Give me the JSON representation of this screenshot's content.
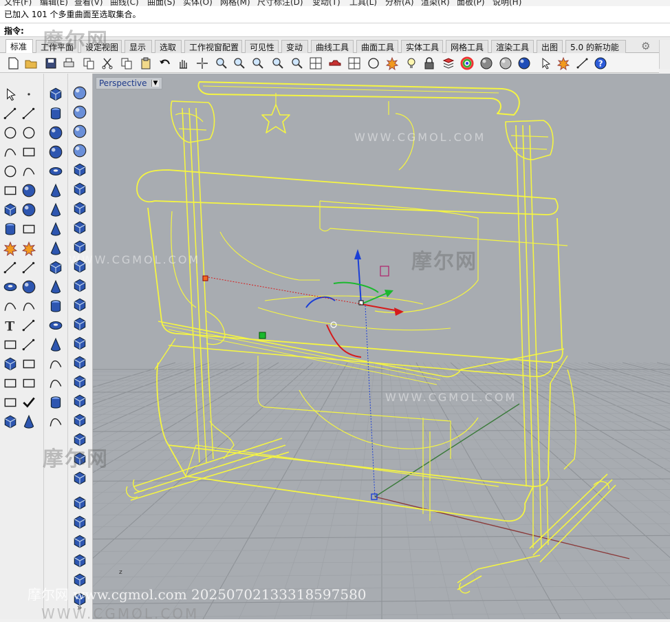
{
  "menubar": {
    "items": [
      "文件(F)",
      "编辑(E)",
      "查看(V)",
      "曲线(C)",
      "曲面(S)",
      "实体(O)",
      "网格(M)",
      "尺寸标注(D)",
      "变动(T)",
      "工具(L)",
      "分析(A)",
      "渲染(R)",
      "面板(P)",
      "说明(H)"
    ]
  },
  "command": {
    "history": "已加入 101 个多重曲面至选取集合。",
    "prompt_label": "指令:",
    "prompt_value": ""
  },
  "tabs": [
    {
      "label": "标准",
      "active": true
    },
    {
      "label": "工作平面",
      "active": false
    },
    {
      "label": "设定视图",
      "active": false
    },
    {
      "label": "显示",
      "active": false
    },
    {
      "label": "选取",
      "active": false
    },
    {
      "label": "工作视窗配置",
      "active": false
    },
    {
      "label": "可见性",
      "active": false
    },
    {
      "label": "变动",
      "active": false
    },
    {
      "label": "曲线工具",
      "active": false
    },
    {
      "label": "曲面工具",
      "active": false
    },
    {
      "label": "实体工具",
      "active": false
    },
    {
      "label": "网格工具",
      "active": false
    },
    {
      "label": "渲染工具",
      "active": false
    },
    {
      "label": "出图",
      "active": false
    },
    {
      "label": "5.0 的新功能",
      "active": false
    }
  ],
  "toolbar": {
    "icons": [
      "new-file-icon",
      "open-folder-icon",
      "save-icon",
      "print-icon",
      "import-icon",
      "cut-icon",
      "copy-icon",
      "paste-icon",
      "undo-icon",
      "pan-hand-icon",
      "move-icon",
      "zoom-icon",
      "zoom-window-icon",
      "zoom-extents-icon",
      "zoom-selected-icon",
      "rotate-view-icon",
      "viewport-layout-icon",
      "car-icon",
      "cplane-icon",
      "select-circle-icon",
      "snap-icon",
      "light-bulb-icon",
      "lock-icon",
      "layer-icon",
      "color-wheel-icon",
      "sphere-shaded-icon",
      "sphere-rendered-icon",
      "sphere-blue-icon",
      "pen-icon",
      "gear-cluster-icon",
      "dimension-icon",
      "help-icon"
    ]
  },
  "viewport": {
    "title": "Perspective",
    "background": "#a8acb1",
    "wire_color": "#f5f542"
  },
  "watermarks": {
    "logo": "摩尔网",
    "url": "WWW.CGMOL.COM",
    "footer": "摩尔网 www.cgmol.com 20250702133318597580"
  },
  "more_label": "»"
}
